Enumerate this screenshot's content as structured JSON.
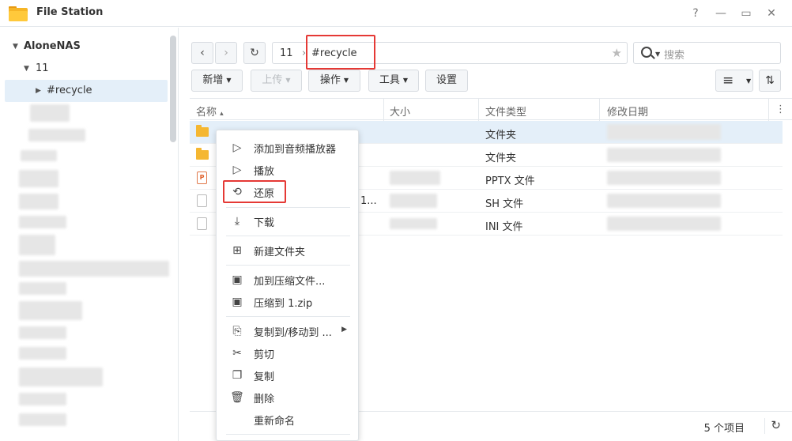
{
  "window": {
    "title": "File Station",
    "help_icon": "?",
    "minimize_icon": "—",
    "maximize_icon": "▭",
    "close_icon": "✕"
  },
  "sidebar": {
    "root": "AloneNAS",
    "share": "11",
    "folder": "#recycle"
  },
  "nav": {
    "back": "‹",
    "forward": "›",
    "refresh": "↻",
    "path_share": "11",
    "path_sep": "›",
    "path_current": "#recycle",
    "star": "★",
    "search_placeholder": "搜索"
  },
  "toolbar": {
    "new_label": "新增",
    "upload_label": "上传",
    "action_label": "操作",
    "tools_label": "工具",
    "settings_label": "设置",
    "view_icon": "≡",
    "sort_icon": "⇅"
  },
  "columns": {
    "name": "名称",
    "name_sort": "▴",
    "size": "大小",
    "type": "文件类型",
    "modified": "修改日期",
    "more": "⋮"
  },
  "files": [
    {
      "icon": "folder",
      "size": "",
      "type": "文件夹",
      "selected": true
    },
    {
      "icon": "folder",
      "size": "",
      "type": "文件夹",
      "selected": false
    },
    {
      "icon": "ppt",
      "size": "",
      "type": "PPTX 文件",
      "selected": false
    },
    {
      "icon": "file",
      "size": "",
      "type": "SH 文件",
      "selected": false,
      "name_tail": "1..."
    },
    {
      "icon": "file",
      "size": "",
      "type": "INI 文件",
      "selected": false
    }
  ],
  "status": {
    "count": "5 个项目",
    "refresh": "↻"
  },
  "context_menu": {
    "add_to_player": "添加到音频播放器",
    "play": "播放",
    "restore": "还原",
    "download": "下载",
    "new_folder": "新建文件夹",
    "add_to_archive": "加到压缩文件...",
    "compress_to": "压缩到 1.zip",
    "copy_move_to": "复制到/移动到 ...",
    "cut": "剪切",
    "copy": "复制",
    "delete": "删除",
    "rename": "重新命名"
  },
  "colors": {
    "highlight": "#e53935",
    "selection": "#e4eff9",
    "folder": "#f5b731"
  }
}
